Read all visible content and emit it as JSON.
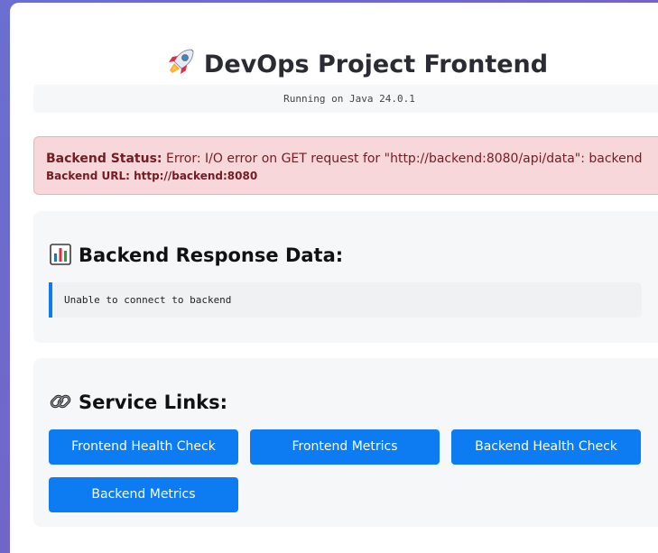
{
  "page": {
    "title": "DevOps Project Frontend",
    "title_icon": "rocket-icon",
    "java_version_text": "Running on Java 24.0.1"
  },
  "status": {
    "label": "Backend Status:",
    "message": "Error: I/O error on GET request for \"http://backend:8080/api/data\": backend",
    "url_text": "Backend URL: http://backend:8080",
    "bg_color": "#f8d7da",
    "text_color": "#721c24"
  },
  "response_section": {
    "icon": "bar-chart-icon",
    "heading": "Backend Response Data:",
    "content": "Unable to connect to backend"
  },
  "links_section": {
    "icon": "link-icon",
    "heading": "Service Links:",
    "buttons": [
      {
        "label": "Frontend Health Check"
      },
      {
        "label": "Frontend Metrics"
      },
      {
        "label": "Backend Health Check"
      },
      {
        "label": "Backend Metrics"
      }
    ]
  },
  "colors": {
    "accent": "#0d7cf2",
    "background_gradient": [
      "#6a6fd0",
      "#7a5bbf"
    ]
  }
}
